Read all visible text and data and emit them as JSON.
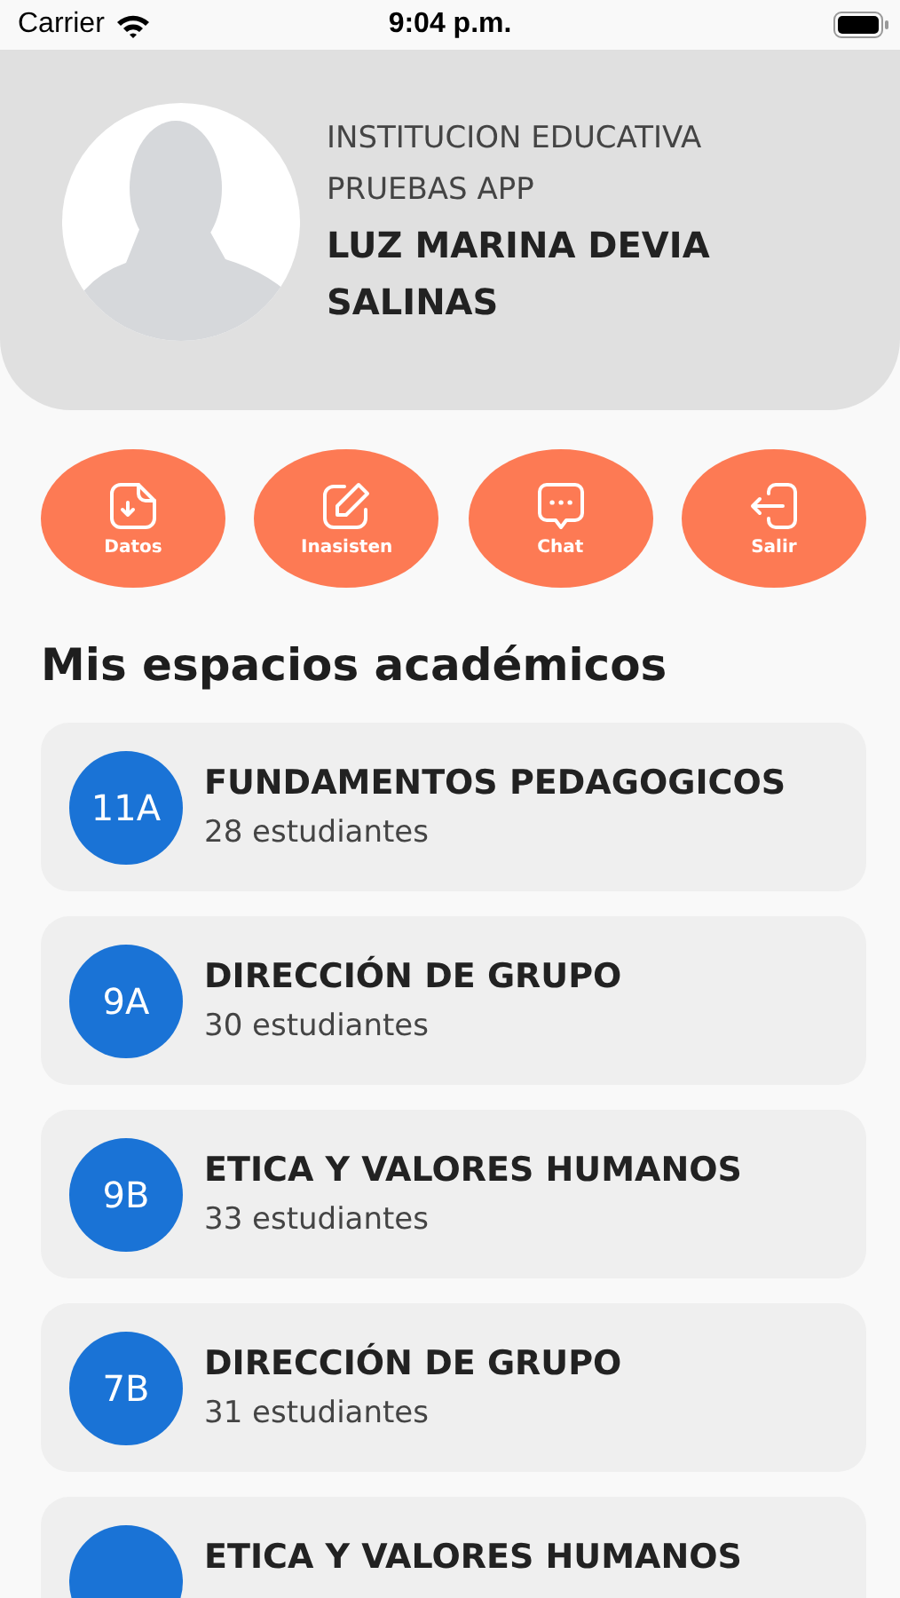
{
  "status_bar": {
    "carrier": "Carrier",
    "time": "9:04 p.m."
  },
  "profile": {
    "institution": "INSTITUCION EDUCATIVA PRUEBAS APP",
    "name": "LUZ MARINA DEVIA SALINAS"
  },
  "actions": [
    {
      "label": "Datos",
      "kind": "download"
    },
    {
      "label": "Inasisten",
      "kind": "edit"
    },
    {
      "label": "Chat",
      "kind": "chat"
    },
    {
      "label": "Salir",
      "kind": "logout"
    }
  ],
  "section_title": "Mis espacios académicos",
  "courses": [
    {
      "code": "11A",
      "title": "FUNDAMENTOS PEDAGOGICOS",
      "students": "28 estudiantes"
    },
    {
      "code": "9A",
      "title": "DIRECCIÓN DE GRUPO",
      "students": "30 estudiantes"
    },
    {
      "code": "9B",
      "title": "ETICA Y VALORES HUMANOS",
      "students": "33 estudiantes"
    },
    {
      "code": "7B",
      "title": "DIRECCIÓN DE GRUPO",
      "students": "31 estudiantes"
    },
    {
      "title": "ETICA Y VALORES HUMANOS"
    }
  ]
}
